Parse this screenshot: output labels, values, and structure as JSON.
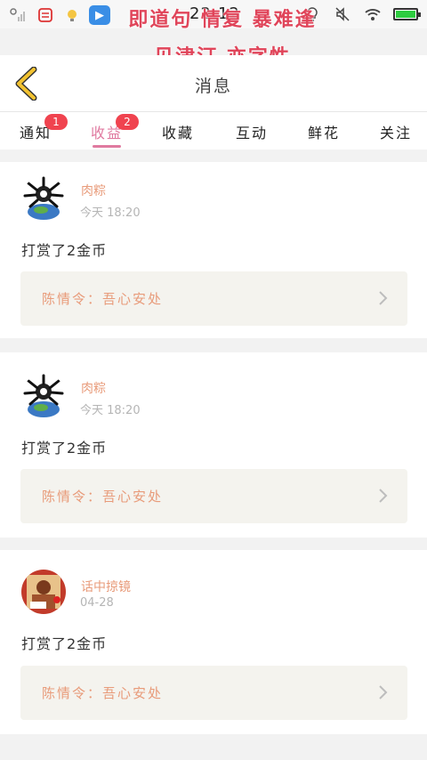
{
  "status_bar": {
    "time": "22:12",
    "app_icon": "blue-app-icon",
    "icons_left": [
      "no-signal-icon",
      "message-icon",
      "lightbulb-icon"
    ],
    "icons_right": [
      "bulb-icon",
      "mute-icon",
      "wifi-icon",
      "battery-icon"
    ]
  },
  "overlay": {
    "line1": "即道句 情复 暴难逢",
    "line2": "见津汀 亦字性"
  },
  "header": {
    "title": "消息",
    "back_icon": "chevron-left-icon"
  },
  "tabs": [
    {
      "label": "通知",
      "badge": "1",
      "active": false
    },
    {
      "label": "收益",
      "badge": "2",
      "active": true
    },
    {
      "label": "收藏",
      "badge": "",
      "active": false
    },
    {
      "label": "互动",
      "badge": "",
      "active": false
    },
    {
      "label": "鲜花",
      "badge": "",
      "active": false
    },
    {
      "label": "关注",
      "badge": "",
      "active": false
    }
  ],
  "notifications": [
    {
      "user": "肉粽",
      "time": "今天 18:20",
      "message": "打赏了2金币",
      "reference": "陈情令：吾心安处"
    },
    {
      "user": "肉粽",
      "time": "今天 18:20",
      "message": "打赏了2金币",
      "reference": "陈情令：吾心安处"
    },
    {
      "user": "话中掠镜",
      "time": "04-28",
      "message": "打赏了2金币",
      "reference": "陈情令：吾心安处"
    }
  ],
  "colors": {
    "accent_pink": "#e07aa0",
    "badge_red": "#f0434f",
    "name_orange": "#e89b7a",
    "back_yellow": "#f2c230"
  }
}
